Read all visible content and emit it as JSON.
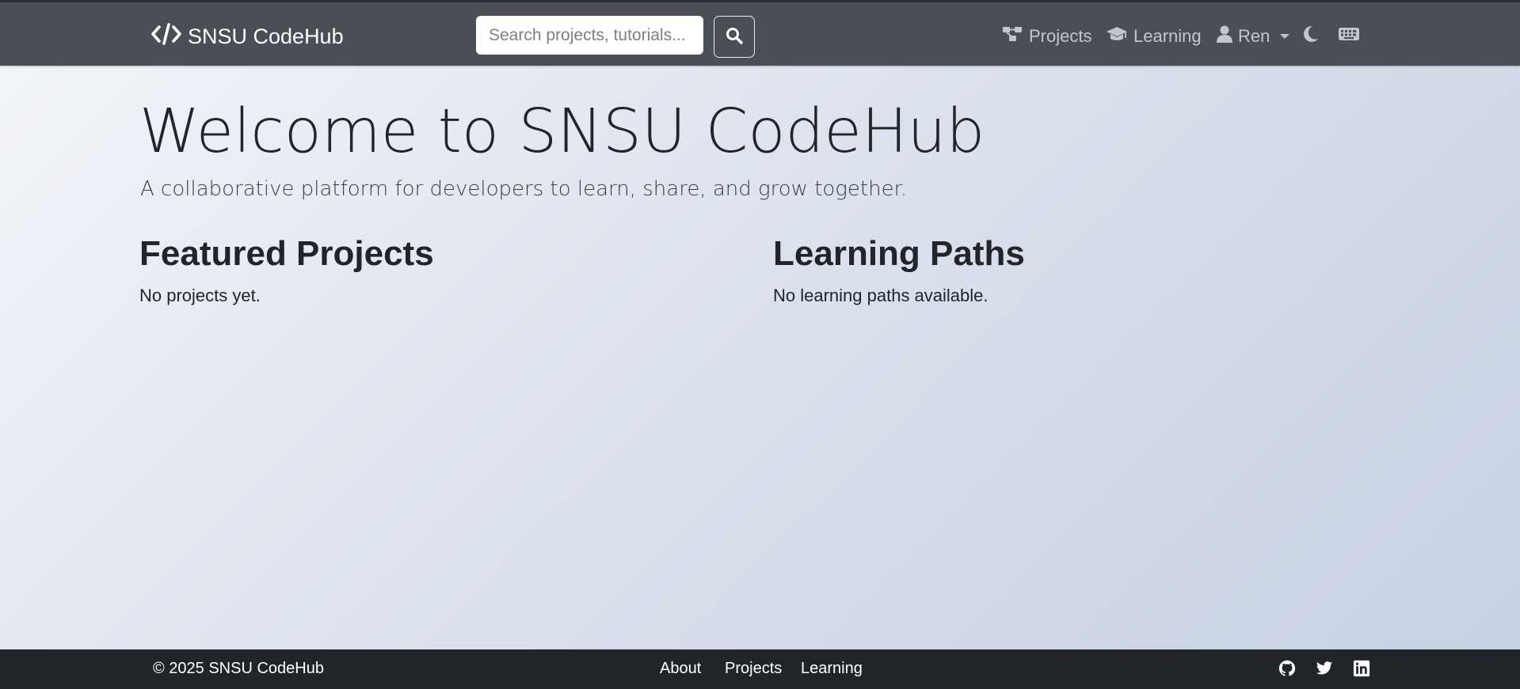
{
  "navbar": {
    "brand": "SNSU CodeHub",
    "brand_icon": "code-icon",
    "search_placeholder": "Search projects, tutorials...",
    "search_icon": "search-icon",
    "items": [
      {
        "label": "Projects",
        "icon": "project-diagram-icon"
      },
      {
        "label": "Learning",
        "icon": "graduation-cap-icon"
      },
      {
        "label": "Ren",
        "icon": "user-icon"
      }
    ],
    "theme_toggle_icon": "moon-icon",
    "shortcuts_icon": "keyboard-icon"
  },
  "hero": {
    "title": "Welcome to SNSU CodeHub",
    "subtitle": "A collaborative platform for developers to learn, share, and grow together."
  },
  "featured": {
    "title": "Featured Projects",
    "empty_text": "No projects yet."
  },
  "learning": {
    "title": "Learning Paths",
    "empty_text": "No learning paths available."
  },
  "footer": {
    "copyright": "© 2025 SNSU CodeHub",
    "links": [
      "About",
      "Projects",
      "Learning"
    ],
    "social_icons": [
      "github-icon",
      "twitter-icon",
      "linkedin-icon"
    ]
  },
  "colors": {
    "navbar_bg": "#4a4f56",
    "footer_bg": "#212529",
    "nav_text": "#c3c7cc",
    "text": "#212529"
  }
}
